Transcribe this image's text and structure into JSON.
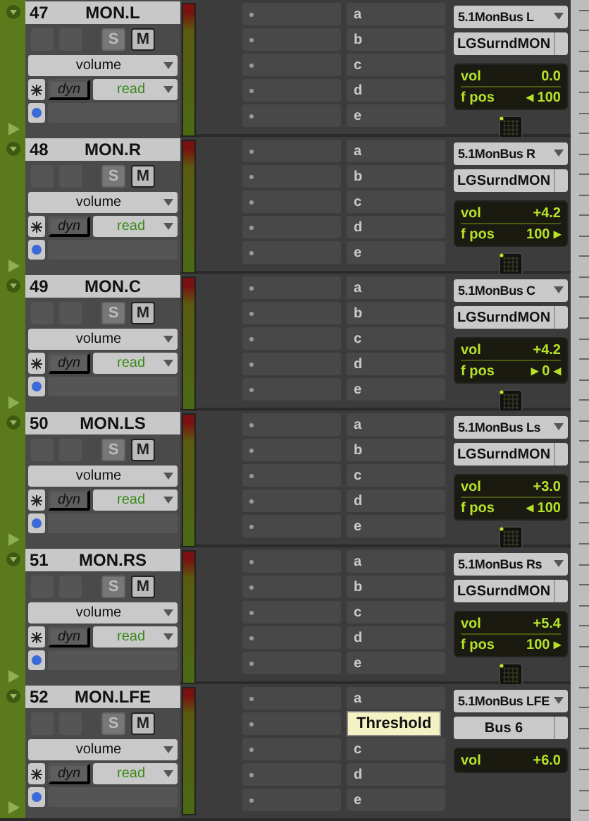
{
  "tracks": [
    {
      "number": "47",
      "name": "MON.L",
      "automation": "volume",
      "dyn": "dyn",
      "mode": "read",
      "solo": "S",
      "mute": "M",
      "sends": [
        {
          "kind": "slot",
          "label": "a"
        },
        {
          "kind": "slot",
          "label": "b"
        },
        {
          "kind": "slot",
          "label": "c"
        },
        {
          "kind": "slot",
          "label": "d"
        },
        {
          "kind": "slot",
          "label": "e"
        }
      ],
      "output": "5.1MonBus L",
      "input": "LGSurndMON",
      "readouts": [
        {
          "label": "vol",
          "value": "0.0"
        },
        {
          "label": "f pos",
          "value": "◂ 100"
        }
      ],
      "panner": true
    },
    {
      "number": "48",
      "name": "MON.R",
      "automation": "volume",
      "dyn": "dyn",
      "mode": "read",
      "solo": "S",
      "mute": "M",
      "sends": [
        {
          "kind": "slot",
          "label": "a"
        },
        {
          "kind": "slot",
          "label": "b"
        },
        {
          "kind": "slot",
          "label": "c"
        },
        {
          "kind": "slot",
          "label": "d"
        },
        {
          "kind": "slot",
          "label": "e"
        }
      ],
      "output": "5.1MonBus R",
      "input": "LGSurndMON",
      "readouts": [
        {
          "label": "vol",
          "value": "+4.2"
        },
        {
          "label": "f pos",
          "value": "100 ▸"
        }
      ],
      "panner": true
    },
    {
      "number": "49",
      "name": "MON.C",
      "automation": "volume",
      "dyn": "dyn",
      "mode": "read",
      "solo": "S",
      "mute": "M",
      "sends": [
        {
          "kind": "slot",
          "label": "a"
        },
        {
          "kind": "slot",
          "label": "b"
        },
        {
          "kind": "slot",
          "label": "c"
        },
        {
          "kind": "slot",
          "label": "d"
        },
        {
          "kind": "slot",
          "label": "e"
        }
      ],
      "output": "5.1MonBus C",
      "input": "LGSurndMON",
      "readouts": [
        {
          "label": "vol",
          "value": "+4.2"
        },
        {
          "label": "f pos",
          "value": "▸ 0 ◂"
        }
      ],
      "panner": true
    },
    {
      "number": "50",
      "name": "MON.LS",
      "automation": "volume",
      "dyn": "dyn",
      "mode": "read",
      "solo": "S",
      "mute": "M",
      "sends": [
        {
          "kind": "slot",
          "label": "a"
        },
        {
          "kind": "slot",
          "label": "b"
        },
        {
          "kind": "slot",
          "label": "c"
        },
        {
          "kind": "slot",
          "label": "d"
        },
        {
          "kind": "slot",
          "label": "e"
        }
      ],
      "output": "5.1MonBus Ls",
      "input": "LGSurndMON",
      "readouts": [
        {
          "label": "vol",
          "value": "+3.0"
        },
        {
          "label": "f pos",
          "value": "◂ 100"
        }
      ],
      "panner": true
    },
    {
      "number": "51",
      "name": "MON.RS",
      "automation": "volume",
      "dyn": "dyn",
      "mode": "read",
      "solo": "S",
      "mute": "M",
      "sends": [
        {
          "kind": "slot",
          "label": "a"
        },
        {
          "kind": "slot",
          "label": "b"
        },
        {
          "kind": "slot",
          "label": "c"
        },
        {
          "kind": "slot",
          "label": "d"
        },
        {
          "kind": "slot",
          "label": "e"
        }
      ],
      "output": "5.1MonBus Rs",
      "input": "LGSurndMON",
      "readouts": [
        {
          "label": "vol",
          "value": "+5.4"
        },
        {
          "label": "f pos",
          "value": "100 ▸"
        }
      ],
      "panner": true
    },
    {
      "number": "52",
      "name": "MON.LFE",
      "automation": "volume",
      "dyn": "dyn",
      "mode": "read",
      "solo": "S",
      "mute": "M",
      "sends": [
        {
          "kind": "slot",
          "label": "a"
        },
        {
          "kind": "tooltip",
          "label": "Threshold"
        },
        {
          "kind": "slot",
          "label": "c"
        },
        {
          "kind": "slot",
          "label": "d"
        },
        {
          "kind": "slot",
          "label": "e"
        }
      ],
      "output": "5.1MonBus LFE",
      "input": "Bus 6",
      "readouts": [
        {
          "label": "vol",
          "value": "+6.0"
        }
      ],
      "panner": false
    }
  ]
}
